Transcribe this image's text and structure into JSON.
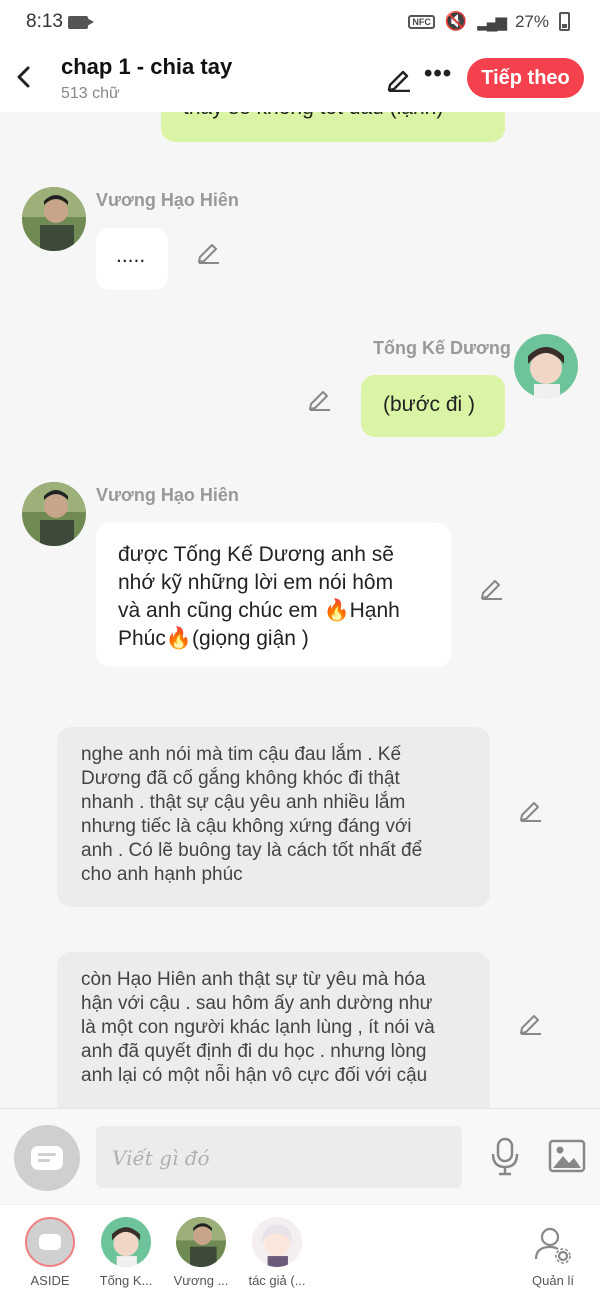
{
  "status_bar": {
    "time": "8:13",
    "battery": "27%"
  },
  "header": {
    "back_icon": "arrow-left-icon",
    "title": "chap 1 - chia tay",
    "word_count": "513 chữ",
    "edit_icon": "pencil-icon",
    "more_icon": "more-dots-icon",
    "next_label": "Tiếp theo",
    "accent_color": "#f4414d"
  },
  "messages": [
    {
      "type": "right-partial",
      "text": "thầy sẽ không tốt đâu (lạnh)"
    },
    {
      "type": "left",
      "speaker": "Vương Hạo Hiên",
      "text": "....."
    },
    {
      "type": "right",
      "speaker": "Tống Kế Dương",
      "text": "(bước đi )"
    },
    {
      "type": "left",
      "speaker": "Vương Hạo Hiên",
      "lines": [
        "được Tống Kế Dương anh sẽ",
        "nhớ kỹ những lời em nói hôm",
        "và anh cũng chúc em",
        "Hạnh",
        "Phúc",
        "(giọng giận )"
      ]
    },
    {
      "type": "narration",
      "lines": [
        "nghe anh nói mà tim cậu đau lắm . Kế",
        "Dương đã cố gắng không khóc đi thật",
        "nhanh . thật sự cậu yêu anh nhiều lắm",
        "nhưng tiếc là cậu không xứng đáng với",
        "anh . Có lẽ buông tay là cách tốt nhất để",
        "cho anh hạnh phúc"
      ]
    },
    {
      "type": "narration",
      "lines": [
        "còn Hạo Hiên anh thật sự từ yêu mà hóa",
        "hận với cậu . sau hôm ấy anh dường như",
        "là một con người khác lạnh lùng , ít nói và",
        "anh đã quyết định đi du học . nhưng lòng",
        "anh lại có một nỗi hận vô cực đối với cậu"
      ]
    }
  ],
  "composer": {
    "placeholder": "Viết gì đó"
  },
  "tabs": [
    {
      "label": "ASIDE"
    },
    {
      "label": "Tống K..."
    },
    {
      "label": "Vương ..."
    },
    {
      "label": "tác giả (..."
    },
    {
      "label": "Quản lí"
    }
  ],
  "colors": {
    "green_bubble": "#d9f4a4",
    "narration_bubble": "#ececec"
  }
}
